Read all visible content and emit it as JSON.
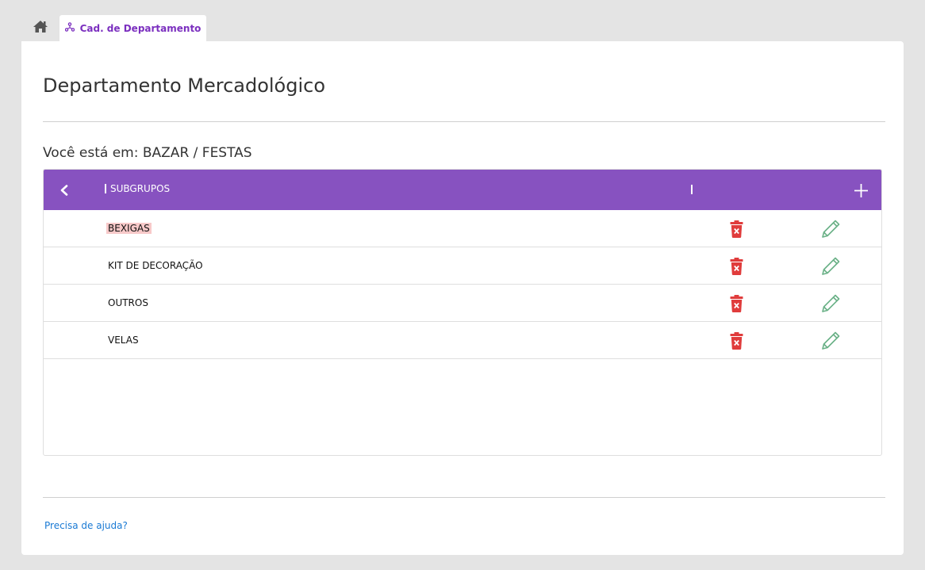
{
  "colors": {
    "accent": "#8752c0",
    "tab_text": "#7b2fbf",
    "delete": "#e03c3c",
    "edit": "#6ab187",
    "highlight": "#f7c9c9",
    "link": "#1a7ad4"
  },
  "tabs": [
    {
      "icon": "home-icon",
      "label": ""
    },
    {
      "icon": "department-icon",
      "label": "Cad. de Departamento",
      "active": true
    }
  ],
  "page": {
    "title": "Departamento Mercadológico",
    "breadcrumb": "Você está em: BAZAR / FESTAS"
  },
  "grid": {
    "back_icon": "chevron-left-icon",
    "column_header": "SUBGRUPOS",
    "add_icon": "plus-icon",
    "rows": [
      {
        "label": "BEXIGAS",
        "highlighted": true
      },
      {
        "label": "KIT DE DECORAÇÃO",
        "highlighted": false
      },
      {
        "label": "OUTROS",
        "highlighted": false
      },
      {
        "label": "VELAS",
        "highlighted": false
      }
    ],
    "delete_icon": "trash-icon",
    "edit_icon": "pencil-icon"
  },
  "footer": {
    "help_link": "Precisa de ajuda?"
  }
}
